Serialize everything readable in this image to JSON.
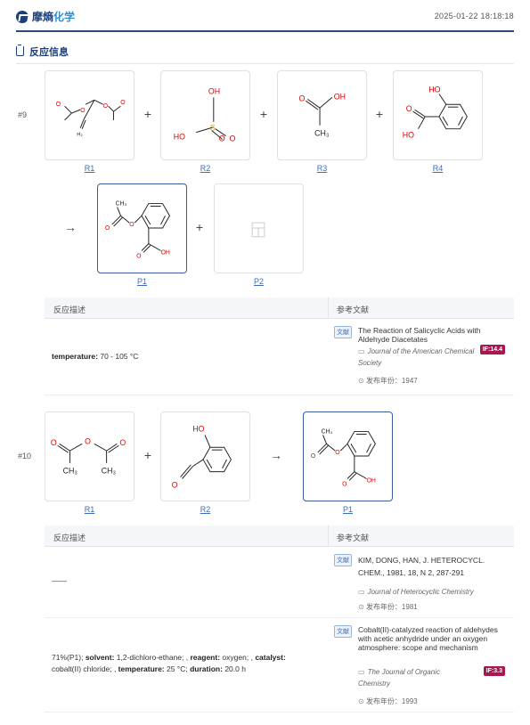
{
  "header": {
    "logo_text_dark": "摩熵",
    "logo_text_light": "化学",
    "timestamp": "2025-01-22 18:18:18"
  },
  "section": {
    "title": "反应信息"
  },
  "colors": {
    "brand": "#1d3f78",
    "accent": "#2b8fd8",
    "link": "#3b6cb4",
    "if_badge": "#a8174f"
  },
  "reactions": [
    {
      "number": "#9",
      "labels": {
        "r1": "R1",
        "r2": "R2",
        "r3": "R3",
        "r4": "R4",
        "p1": "P1",
        "p2": "P2"
      },
      "atoms": {
        "r1": [
          "O",
          "O",
          "O",
          "O",
          "H₂"
        ],
        "r2": [
          "OH",
          "HO",
          "S",
          "O",
          "O"
        ],
        "r3": [
          "OH",
          "O",
          "CH₃"
        ],
        "r4": [
          "HO",
          "O",
          "HO"
        ],
        "p1": [
          "CH₃",
          "O",
          "O",
          "O",
          "OH"
        ]
      },
      "table": {
        "col_desc": "反应描述",
        "col_ref": "参考文献",
        "rows": [
          {
            "desc_label": "temperature:",
            "desc_value": "70 - 105 °C",
            "ref_tag": "文献",
            "ref_title": "The Reaction of Salicyclic Acids with Aldehyde Diacetates",
            "ref_journal": "Journal of the American Chemical Society",
            "ref_year": "发布年份：1947",
            "if": "IF:14.4"
          }
        ]
      }
    },
    {
      "number": "#10",
      "labels": {
        "r1": "R1",
        "r2": "R2",
        "p1": "P1"
      },
      "atoms": {
        "r1": [
          "O",
          "O",
          "O",
          "CH₃",
          "CH₃"
        ],
        "r2": [
          "HO",
          "O"
        ],
        "p1": [
          "CH₃",
          "O",
          "O",
          "O",
          "OH"
        ]
      },
      "table": {
        "col_desc": "反应描述",
        "col_ref": "参考文献",
        "rows": [
          {
            "desc_plain": "——",
            "ref_tag": "文献",
            "ref_title": "KIM, DONG, HAN, J. HETEROCYCL. CHEM., 1981, 18, N 2, 287-291",
            "ref_journal": "Journal of Heterocyclic Chemistry",
            "ref_year": "发布年份：1981"
          },
          {
            "desc_l1a": "71%(P1);",
            "desc_solvent_label": "solvent:",
            "desc_solvent": "1,2-dichloro-ethane;",
            "desc_reagent_label": "reagent:",
            "desc_reagent": "oxygen;",
            "desc_catalyst_label": "catalyst:",
            "desc_catalyst": "cobalt(II) chloride;",
            "desc_temp_label": "temperature:",
            "desc_temp": "25 °C;",
            "desc_dur_label": "duration:",
            "desc_dur": "20.0 h",
            "ref_tag": "文献",
            "ref_title": "Cobalt(II)-catalyzed reaction of aldehydes with acetic anhydride under an oxygen atmosphere: scope and mechanism",
            "ref_journal": "The Journal of Organic Chemistry",
            "ref_year": "发布年份：1993",
            "if": "IF:3.3"
          }
        ]
      }
    }
  ]
}
